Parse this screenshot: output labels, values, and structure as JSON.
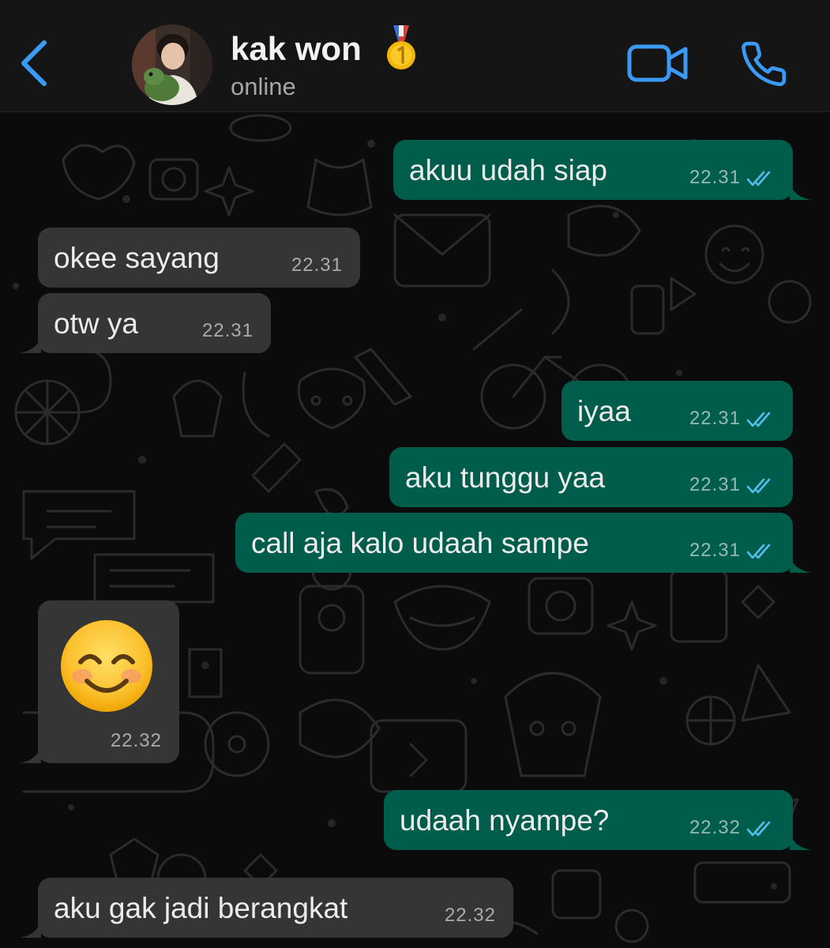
{
  "header": {
    "contact_name": "kak won",
    "contact_status": "online",
    "icons": {
      "back": "chevron-left-icon",
      "badge": "first-place-medal-icon",
      "video": "video-camera-icon",
      "call": "phone-icon"
    }
  },
  "colors": {
    "accent": "#3b9af5",
    "bubble_outgoing": "#005c4b",
    "bubble_incoming": "#353535",
    "header_bg": "#151515",
    "chat_bg": "#0b0b0b",
    "read_ticks": "#53bdeb"
  },
  "messages": [
    {
      "direction": "outgoing",
      "text": "akuu udah siap",
      "time": "22.31",
      "status": "read"
    },
    {
      "direction": "incoming",
      "text": "okee sayang",
      "time": "22.31"
    },
    {
      "direction": "incoming",
      "text": "otw ya",
      "time": "22.31"
    },
    {
      "direction": "outgoing",
      "text": "iyaa",
      "time": "22.31",
      "status": "read"
    },
    {
      "direction": "outgoing",
      "text": "aku tunggu yaa",
      "time": "22.31",
      "status": "read"
    },
    {
      "direction": "outgoing",
      "text": "call aja kalo udaah sampe",
      "time": "22.31",
      "status": "read"
    },
    {
      "direction": "incoming",
      "emoji": "smiling-face-with-smiling-eyes",
      "time": "22.32"
    },
    {
      "direction": "outgoing",
      "text": "udaah nyampe?",
      "time": "22.32",
      "status": "read"
    },
    {
      "direction": "incoming",
      "text": "aku gak jadi berangkat",
      "time": "22.32"
    }
  ]
}
